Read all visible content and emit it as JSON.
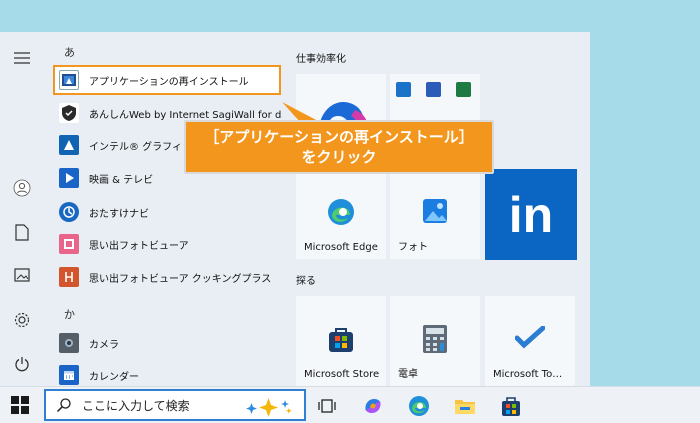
{
  "start_menu": {
    "applist": {
      "section_a": "あ",
      "section_ka": "か",
      "items": [
        {
          "label": "アプリケーションの再インストール",
          "icon": "reinstall-app-icon"
        },
        {
          "label": "あんしんWeb by Internet SagiWall for d…",
          "icon": "sagiwall-icon"
        },
        {
          "label": "インテル® グラフィックス…",
          "icon": "intel-graphics-icon"
        },
        {
          "label": "映画 & テレビ",
          "icon": "movies-tv-icon"
        },
        {
          "label": "おたすけナビ",
          "icon": "otasuke-navi-icon"
        },
        {
          "label": "思い出フォトビューア",
          "icon": "photo-viewer-icon"
        },
        {
          "label": "思い出フォトビューア クッキングプラス",
          "icon": "cooking-plus-icon"
        },
        {
          "label": "カメラ",
          "icon": "camera-icon"
        },
        {
          "label": "カレンダー",
          "icon": "calendar-icon"
        }
      ]
    },
    "tiles": {
      "group_productivity": "仕事効率化",
      "group_explore": "探る",
      "edge_label": "Microsoft Edge",
      "photos_label": "フォト",
      "store_label": "Microsoft Store",
      "calculator_label": "電卓",
      "todo_label": "Microsoft To…",
      "linkedin_text": "in"
    }
  },
  "callout": {
    "line1": "［アプリケーションの再インストール］",
    "line2": "をクリック"
  },
  "taskbar": {
    "search_placeholder": "ここに入力して検索"
  },
  "colors": {
    "accent_orange": "#f3961e",
    "linkedin_blue": "#0a66c2",
    "search_border": "#2f7fd2",
    "desktop": "#a6dbe9"
  }
}
